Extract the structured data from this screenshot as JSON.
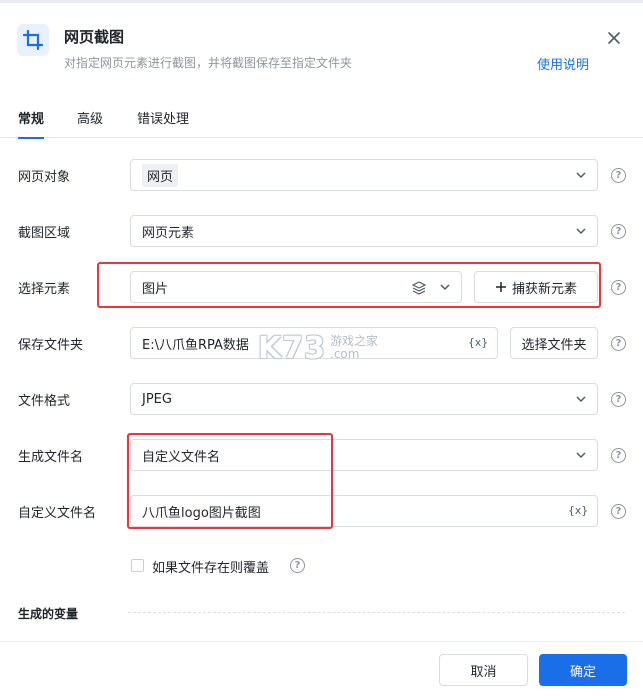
{
  "header": {
    "title": "网页截图",
    "subtitle": "对指定网页元素进行截图，并将截图保存至指定文件夹",
    "help_link": "使用说明",
    "icon": "crop-icon",
    "close_icon": "close-icon"
  },
  "tabs": [
    {
      "label": "常规",
      "active": true
    },
    {
      "label": "高级",
      "active": false
    },
    {
      "label": "错误处理",
      "active": false
    }
  ],
  "form": {
    "web_object": {
      "label": "网页对象",
      "value": "网页"
    },
    "capture_area": {
      "label": "截图区域",
      "value": "网页元素"
    },
    "select_element": {
      "label": "选择元素",
      "value": "图片",
      "capture_button": "捕获新元素"
    },
    "save_folder": {
      "label": "保存文件夹",
      "value": "E:\\八爪鱼RPA数据",
      "var_icon": "{x}",
      "choose_button": "选择文件夹"
    },
    "file_format": {
      "label": "文件格式",
      "value": "JPEG"
    },
    "filename_mode": {
      "label": "生成文件名",
      "value": "自定义文件名"
    },
    "custom_filename": {
      "label": "自定义文件名",
      "value": "八爪鱼logo图片截图",
      "var_icon": "{x}"
    },
    "overwrite": {
      "label": "如果文件存在则覆盖",
      "checked": false
    }
  },
  "section": {
    "title": "生成的变量"
  },
  "footer": {
    "cancel": "取消",
    "confirm": "确定"
  },
  "watermark": {
    "logo": "K73",
    "line1": "游戏之家",
    "line2": ".com"
  },
  "colors": {
    "accent": "#1a6fe8",
    "highlight_box": "#e53935"
  }
}
